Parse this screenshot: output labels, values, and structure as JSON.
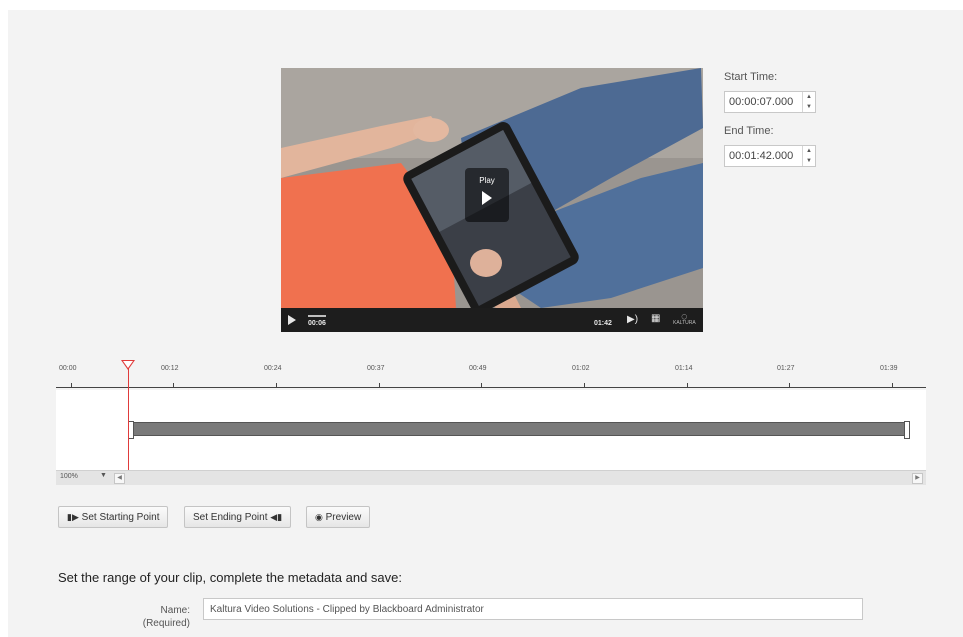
{
  "video": {
    "overlay_label": "Play",
    "current_time": "00:06",
    "duration": "01:42",
    "brand": "KALTURA",
    "progress_fraction": 0.06
  },
  "clip": {
    "start_label": "Start Time:",
    "start_value": "00:00:07.000",
    "end_label": "End Time:",
    "end_value": "00:01:42.000"
  },
  "timeline": {
    "tick_labels": [
      "00:00",
      "00:12",
      "00:24",
      "00:37",
      "00:49",
      "01:02",
      "01:14",
      "01:27",
      "01:39"
    ],
    "zoom": "100%",
    "colors": {
      "playhead": "#e03b3b",
      "clip_bar": "#7a7a7a"
    }
  },
  "buttons": {
    "set_start": "Set Starting Point",
    "set_end": "Set Ending Point",
    "preview": "Preview"
  },
  "form": {
    "instructions": "Set the range of your clip, complete the metadata and save:",
    "name_label": "Name:",
    "name_required": "(Required)",
    "name_value": "Kaltura Video Solutions - Clipped by Blackboard Administrator"
  }
}
